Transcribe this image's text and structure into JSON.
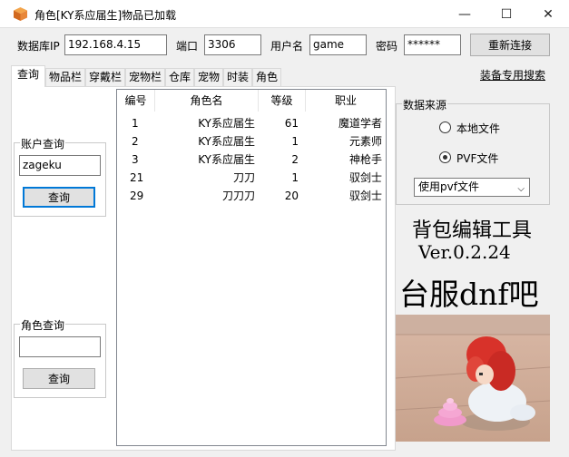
{
  "window": {
    "title": "角色[KY系应届生]物品已加载",
    "min_glyph": "—",
    "max_glyph": "☐",
    "close_glyph": "✕"
  },
  "connection": {
    "ip_label": "数据库IP",
    "ip_value": "192.168.4.15",
    "port_label": "端口",
    "port_value": "3306",
    "user_label": "用户名",
    "user_value": "game",
    "password_label": "密码",
    "password_value": "******",
    "reconnect_label": "重新连接"
  },
  "tabs": [
    "查询",
    "物品栏",
    "穿戴栏",
    "宠物栏",
    "仓库",
    "宠物",
    "时装",
    "角色"
  ],
  "equip_search_link": "装备专用搜索",
  "account_query": {
    "group_title": "账户查询",
    "input_value": "zageku",
    "button_label": "查询"
  },
  "role_query": {
    "group_title": "角色查询",
    "input_value": "",
    "button_label": "查询"
  },
  "table": {
    "columns": [
      "编号",
      "角色名",
      "等级",
      "职业"
    ],
    "rows": [
      [
        "1",
        "KY系应届生",
        "61",
        "魔道学者"
      ],
      [
        "2",
        "KY系应届生",
        "1",
        "元素师"
      ],
      [
        "3",
        "KY系应届生",
        "2",
        "神枪手"
      ],
      [
        "21",
        "刀刀",
        "1",
        "驭剑士"
      ],
      [
        "29",
        "刀刀刀",
        "20",
        "驭剑士"
      ]
    ]
  },
  "data_source": {
    "group_title": "数据来源",
    "local_label": "本地文件",
    "pvf_label": "PVF文件",
    "selected": "pvf",
    "select_value": "使用pvf文件"
  },
  "banner": {
    "line1": "背包编辑工具",
    "line2": "Ver.0.2.24",
    "line3": "台服dnf吧"
  },
  "colors": {
    "accent": "#0078d7",
    "titlebar": "#ffffff",
    "window_bg": "#f0f0f0"
  }
}
